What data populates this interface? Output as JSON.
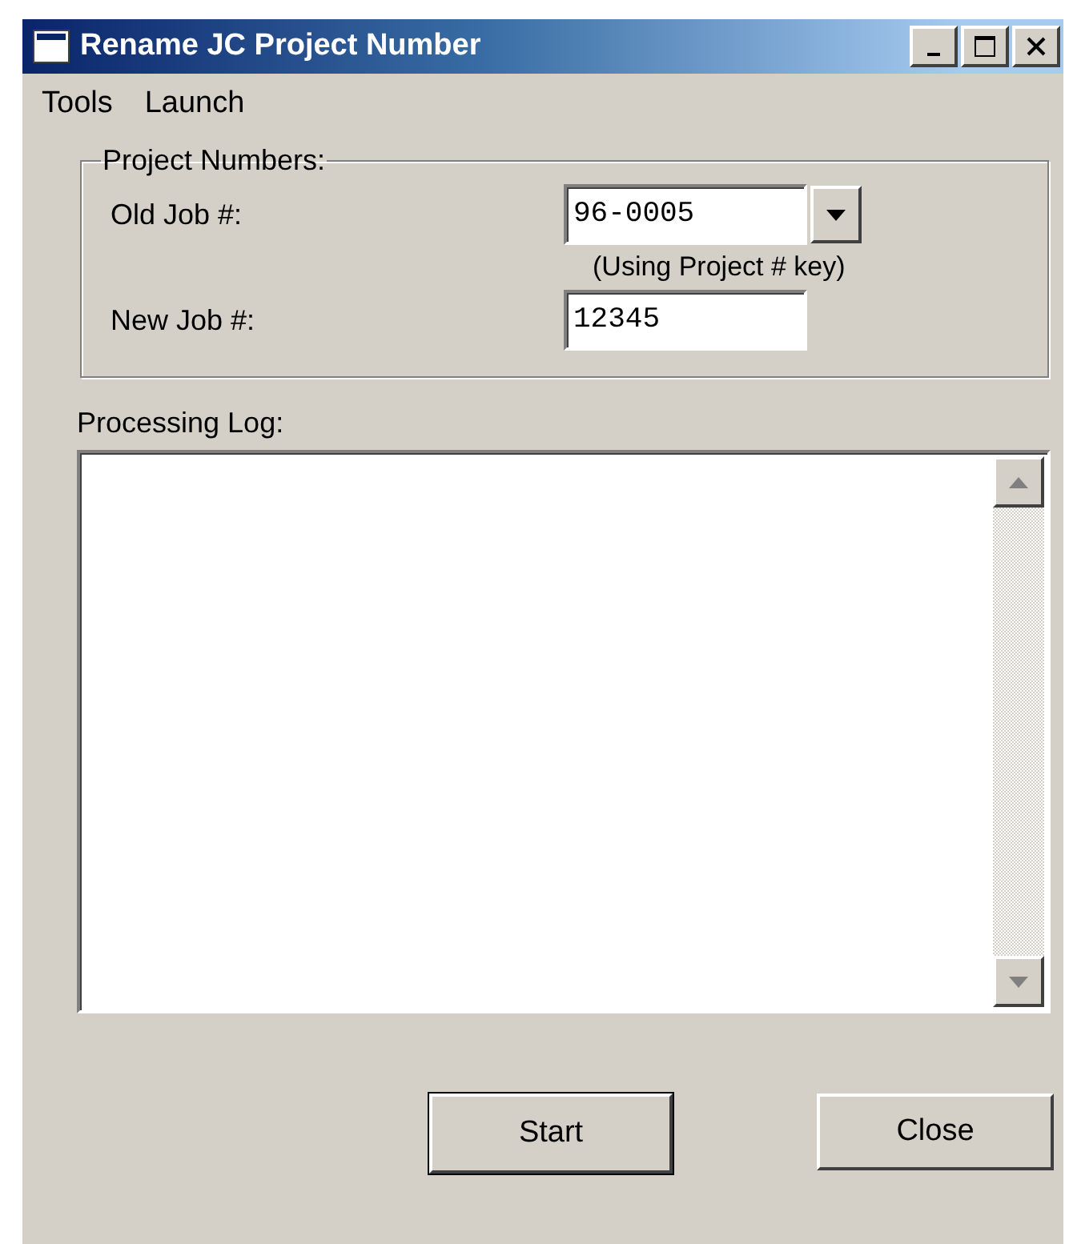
{
  "window": {
    "title": "Rename JC Project Number"
  },
  "menu": [
    {
      "label": "Tools"
    },
    {
      "label": "Launch"
    }
  ],
  "project_numbers": {
    "legend": "Project Numbers:",
    "old_job": {
      "label": "Old Job #:",
      "value": "96-0005",
      "hint": "(Using Project # key)"
    },
    "new_job": {
      "label": "New Job #:",
      "value": "12345"
    }
  },
  "processing_log": {
    "label": "Processing Log:"
  },
  "buttons": [
    {
      "label": "Start",
      "default": true
    },
    {
      "label": "Close",
      "default": false
    }
  ]
}
